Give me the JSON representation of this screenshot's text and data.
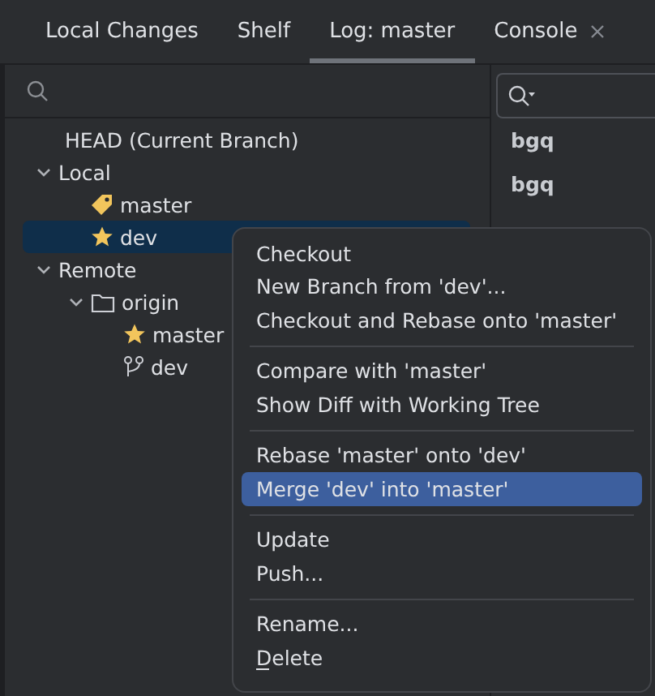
{
  "tabs": [
    {
      "label": "Local Changes",
      "selected": false,
      "closable": false
    },
    {
      "label": "Shelf",
      "selected": false,
      "closable": false
    },
    {
      "label": "Log: master",
      "selected": true,
      "closable": false
    },
    {
      "label": "Console",
      "selected": false,
      "closable": true
    }
  ],
  "branch_tree": [
    {
      "label": "HEAD (Current Branch)",
      "kind": "plain",
      "selected": false
    },
    {
      "label": "Local",
      "kind": "group",
      "expanded": true,
      "selected": false,
      "children": [
        {
          "label": "master",
          "kind": "tag",
          "selected": false
        },
        {
          "label": "dev",
          "kind": "star",
          "selected": true
        }
      ]
    },
    {
      "label": "Remote",
      "kind": "group",
      "expanded": true,
      "selected": false,
      "children": [
        {
          "label": "origin",
          "kind": "folder",
          "expanded": true,
          "selected": false,
          "children": [
            {
              "label": "master",
              "kind": "star",
              "selected": false
            },
            {
              "label": "dev",
              "kind": "branch",
              "selected": false
            }
          ]
        }
      ]
    }
  ],
  "commits": [
    "bgq",
    "bgq"
  ],
  "context_menu": [
    [
      {
        "label": "Checkout",
        "selected": false
      },
      {
        "label": "New Branch from 'dev'...",
        "selected": false
      },
      {
        "label": "Checkout and Rebase onto 'master'",
        "selected": false
      }
    ],
    [
      {
        "label": "Compare with 'master'",
        "selected": false
      },
      {
        "label": "Show Diff with Working Tree",
        "selected": false
      }
    ],
    [
      {
        "label": "Rebase 'master' onto 'dev'",
        "selected": false
      },
      {
        "label": "Merge 'dev' into 'master'",
        "selected": true
      }
    ],
    [
      {
        "label": "Update",
        "selected": false
      },
      {
        "label": "Push...",
        "selected": false
      }
    ],
    [
      {
        "label": "Rename...",
        "selected": false
      },
      {
        "label": "Delete",
        "selected": false,
        "mnemonic": true
      }
    ]
  ]
}
